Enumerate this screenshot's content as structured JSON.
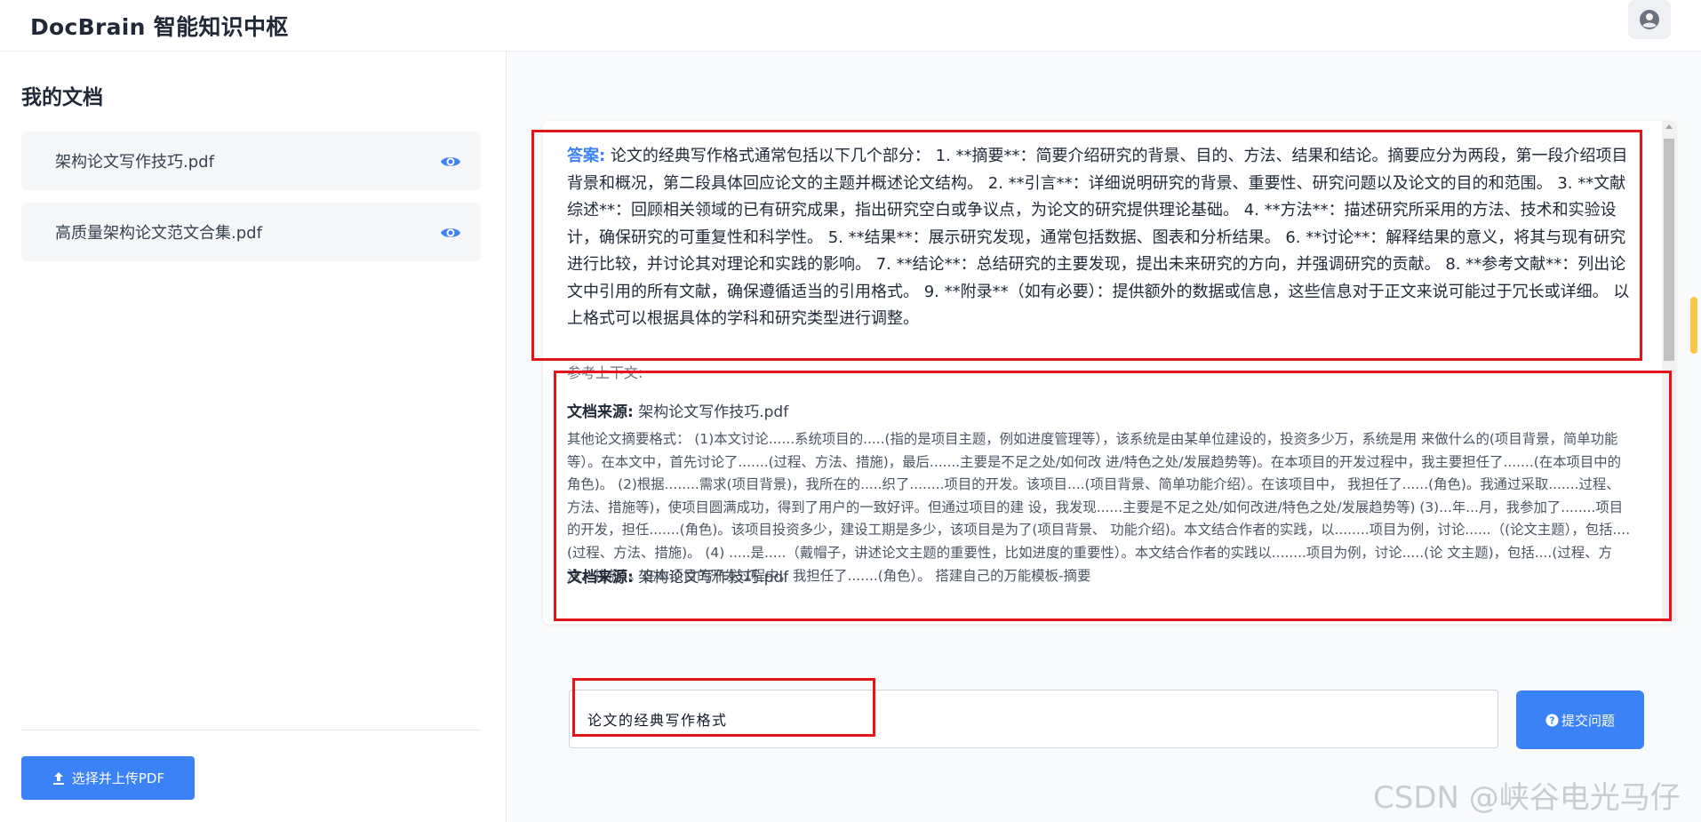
{
  "app": {
    "title": "DocBrain 智能知识中枢",
    "avatar_icon": "user-circle-icon"
  },
  "sidebar": {
    "heading": "我的文档",
    "documents": [
      {
        "name": "架构论文写作技巧.pdf",
        "icon": "eye-icon"
      },
      {
        "name": "高质量架构论文范文合集.pdf",
        "icon": "eye-icon"
      }
    ],
    "upload_label": "选择并上传PDF",
    "upload_icon": "upload-icon"
  },
  "chat": {
    "answer_label": "答案:",
    "answer_text": " 论文的经典写作格式通常包括以下几个部分： 1. **摘要**：简要介绍研究的背景、目的、方法、结果和结论。摘要应分为两段，第一段介绍项目背景和概况，第二段具体回应论文的主题并概述论文结构。 2. **引言**：详细说明研究的背景、重要性、研究问题以及论文的目的和范围。 3. **文献综述**：回顾相关领域的已有研究成果，指出研究空白或争议点，为论文的研究提供理论基础。 4. **方法**：描述研究所采用的方法、技术和实验设计，确保研究的可重复性和科学性。 5. **结果**：展示研究发现，通常包括数据、图表和分析结果。 6. **讨论**：解释结果的意义，将其与现有研究进行比较，并讨论其对理论和实践的影响。 7. **结论**：总结研究的主要发现，提出未来研究的方向，并强调研究的贡献。 8. **参考文献**：列出论文中引用的所有文献，确保遵循适当的引用格式。 9. **附录**（如有必要）：提供额外的数据或信息，这些信息对于正文来说可能过于冗长或详细。 以上格式可以根据具体的学科和研究类型进行调整。",
    "context_label": "参考上下文:",
    "sources": [
      {
        "label": "文档来源:",
        "file": " 架构论文写作技巧.pdf",
        "excerpt": "其他论文摘要格式： (1)本文讨论......系统项目的.....(指的是项目主题，例如进度管理等），该系统是由某单位建设的，投资多少万，系统是用 来做什么的(项目背景，简单功能等）。在本文中，首先讨论了.......(过程、方法、措施)，最后.......主要是不足之处/如何改 进/特色之处/发展趋势等)。在本项目的开发过程中，我主要担任了.......(在本项目中的角色)。 (2)根据........需求(项目背景)，我所在的.....织了........项目的开发。该项目....(项目背景、简单功能介绍）。在该项目中， 我担任了......(角色)。我通过采取.......过程、方法、措施等)，使项目圆满成功，得到了用户的一致好评。但通过项目的建 设，我发现......主要是不足之处/如何改进/特色之处/发展趋势等) (3)...年...月，我参加了........项目的开发，担任.......(角色)。该项目投资多少，建设工期是多少，该项目是为了(项目背景、 功能介绍)。本文结合作者的实践，以........项目为例，讨论......（(论文主题），包括....(过程、方法、措施)。 (4) .....是.....（戴帽子，讲述论文主题的重要性，比如进度的重要性）。本文结合作者的实践以........项目为例，讨论.....(论 文主题)，包括....(过程、方法、措施）。在本项目的开发过程中，我担任了.......(角色）。 搭建自己的万能模板-摘要"
      },
      {
        "label": "文档来源:",
        "file": " 架构论文写作技巧.pdf",
        "excerpt": ""
      }
    ]
  },
  "input": {
    "value": "论文的经典写作格式"
  },
  "submit": {
    "label": "提交问题",
    "icon": "question-circle-icon"
  },
  "watermark": "CSDN @峡谷电光马仔",
  "colors": {
    "accent": "#3b82f6",
    "highlight_border": "#e3141a"
  }
}
